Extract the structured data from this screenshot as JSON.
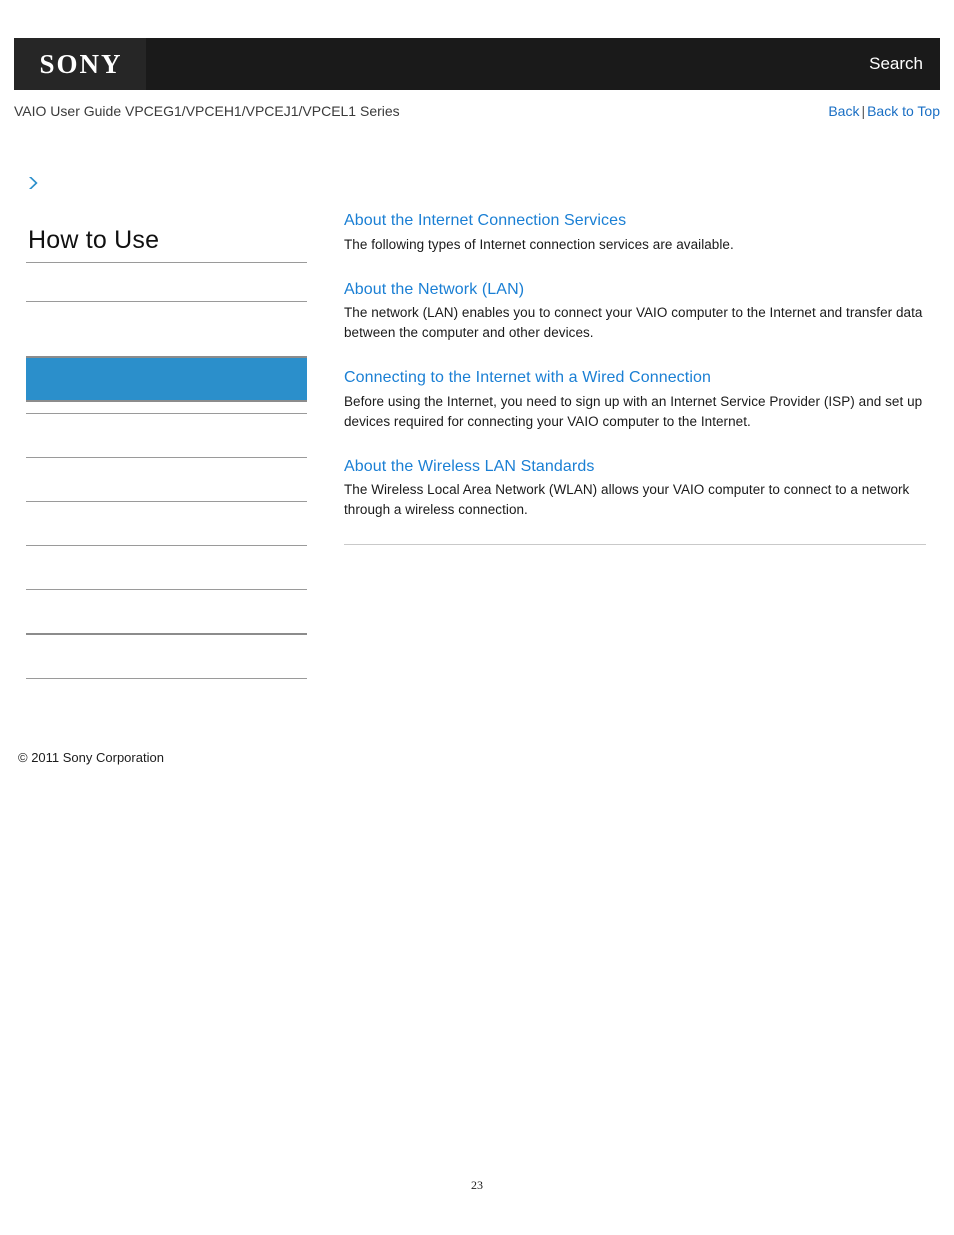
{
  "header": {
    "logo_text": "SONY",
    "search_label": "Search",
    "guide_title": "VAIO User Guide VPCEG1/VPCEH1/VPCEJ1/VPCEL1 Series",
    "back_label": "Back",
    "separator": "|",
    "back_to_top_label": "Back to Top"
  },
  "breadcrumb": {
    "icon": "chevron-right-icon",
    "text": ""
  },
  "sidebar": {
    "heading": "How to Use",
    "items": [
      {
        "label": "",
        "selected": false
      },
      {
        "label": "",
        "selected": false
      },
      {
        "label": "",
        "selected": true
      },
      {
        "label": "",
        "selected": false
      },
      {
        "label": "",
        "selected": false
      },
      {
        "label": "",
        "selected": false
      },
      {
        "label": "",
        "selected": false
      },
      {
        "label": "",
        "selected": false
      },
      {
        "label": "",
        "selected": false
      }
    ],
    "copyright": "© 2011 Sony Corporation"
  },
  "content": {
    "sections": [
      {
        "link": "About the Internet Connection Services",
        "description": "The following types of Internet connection services are available."
      },
      {
        "link": "About the Network (LAN)",
        "description": "The network (LAN) enables you to connect your VAIO computer to the Internet and transfer data between the computer and other devices."
      },
      {
        "link": "Connecting to the Internet with a Wired Connection",
        "description": "Before using the Internet, you need to sign up with an Internet Service Provider (ISP) and set up devices required for connecting your VAIO computer to the Internet."
      },
      {
        "link": "About the Wireless LAN Standards",
        "description": "The Wireless Local Area Network (WLAN) allows your VAIO computer to connect to a network through a wireless connection."
      }
    ]
  },
  "footer": {
    "page_number": "23"
  },
  "colors": {
    "header_black": "#1a1a1a",
    "logo_box": "#262626",
    "link_blue": "#1a7fd4",
    "nav_blue": "#1a6fc4",
    "selected_blue": "#2b8fcb",
    "rule_gray": "#9a9a9a"
  }
}
